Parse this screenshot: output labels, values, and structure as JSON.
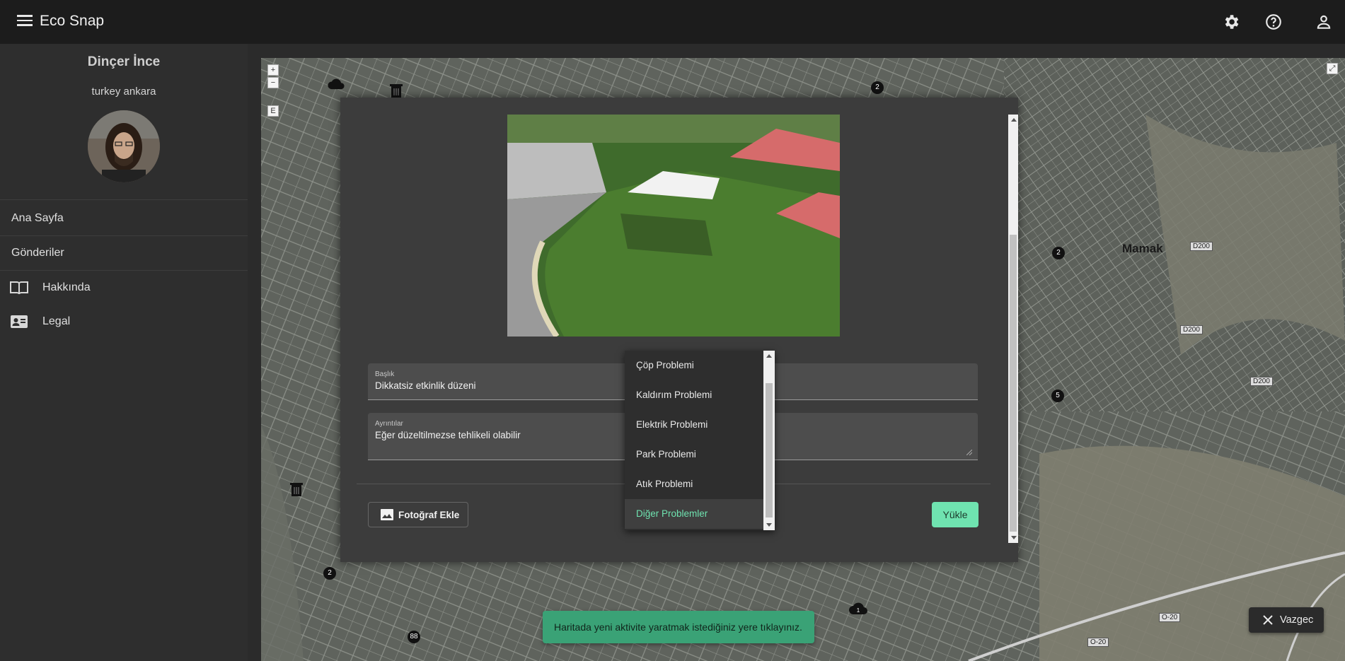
{
  "app": {
    "title": "Eco Snap"
  },
  "header": {
    "icons": [
      "gear-icon",
      "help-icon",
      "account-icon"
    ]
  },
  "sidebar": {
    "user_name": "Dinçer İnce",
    "user_location": "turkey ankara",
    "items": [
      {
        "label": "Ana Sayfa"
      },
      {
        "label": "Gönderiler"
      },
      {
        "label": "Hakkında",
        "icon": "book-icon"
      },
      {
        "label": "Legal",
        "icon": "contact-card-icon"
      }
    ]
  },
  "map": {
    "zoom_in": "+",
    "zoom_out": "−",
    "layer_button": "E",
    "place_labels": [
      {
        "text": "Mamak"
      },
      {
        "text": "D200"
      },
      {
        "text": "D200"
      },
      {
        "text": "D200"
      },
      {
        "text": "O-20"
      },
      {
        "text": "O-20"
      }
    ],
    "markers": [
      "2",
      "2",
      "5",
      "2",
      "88",
      "1"
    ]
  },
  "modal": {
    "title_field": {
      "label": "Başlık",
      "value": "Dikkatsiz etkinlik düzeni"
    },
    "details_field": {
      "label": "Ayrıntılar",
      "value": "Eğer düzeltilmezse tehlikeli olabilir"
    },
    "photo_button": "Fotoğraf Ekle",
    "upload_button": "Yükle"
  },
  "dropdown": {
    "options": [
      {
        "label": "Çöp Problemi"
      },
      {
        "label": "Kaldırım Problemi"
      },
      {
        "label": "Elektrik Problemi"
      },
      {
        "label": "Park Problemi"
      },
      {
        "label": "Atık Problemi"
      },
      {
        "label": "Diğer Problemler"
      }
    ],
    "selected": "Diğer Problemler"
  },
  "toast": {
    "message": "Haritada yeni aktivite yaratmak istediğiniz yere tıklayınız."
  },
  "cancel": {
    "label": "Vazgec"
  },
  "colors": {
    "accent": "#6fe3b0",
    "toast": "#3aa276",
    "topbar": "#1c1c1c",
    "sidebar": "#2e2e2e"
  }
}
